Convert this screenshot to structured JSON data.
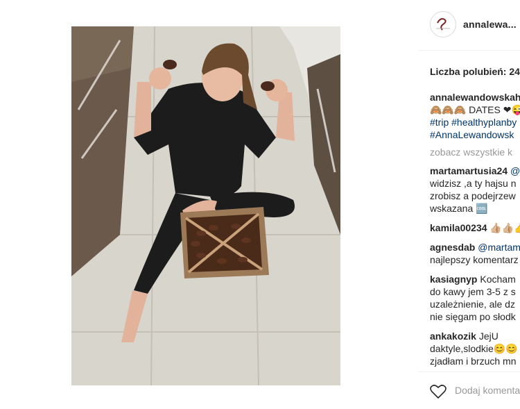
{
  "post": {
    "username": "annalewa...",
    "likes_text": "Liczba polubień: 24"
  },
  "caption": {
    "username": "annalewandowskah",
    "line2": "🙈🙈🙈 DATES ❤😜",
    "line3": "#trip #healthyplanby",
    "line4": "#AnnaLewandowsk"
  },
  "view_all": "zobacz wszystkie k",
  "comments": [
    {
      "username": "martamartusia24",
      "text_inline": " @",
      "lines": [
        "widzisz ,a ty hajsu n",
        "zrobisz a podejrzew",
        "wskazana 🆒"
      ]
    },
    {
      "username": "kamila00234",
      "text_inline": " 👍🏼👍🏼👍",
      "lines": []
    },
    {
      "username": "agnesdab",
      "text_inline": " @martam",
      "lines": [
        "najlepszy komentarz"
      ]
    },
    {
      "username": "kasiagnyp",
      "text_inline": " Kocham",
      "lines": [
        "do kawy jem 3-5 z s",
        "uzależnienie, ale dz",
        "nie sięgam po słodk"
      ]
    },
    {
      "username": "ankakozik",
      "text_inline": " JejU",
      "lines": [
        "daktyle,slodkie😊😊",
        "zjadłam i brzuch mn"
      ]
    }
  ],
  "add_comment_placeholder": "Dodaj komenta",
  "colors": {
    "link": "#003569",
    "muted": "#999999",
    "text": "#262626"
  },
  "icons": [
    "heart-icon",
    "avatar"
  ]
}
